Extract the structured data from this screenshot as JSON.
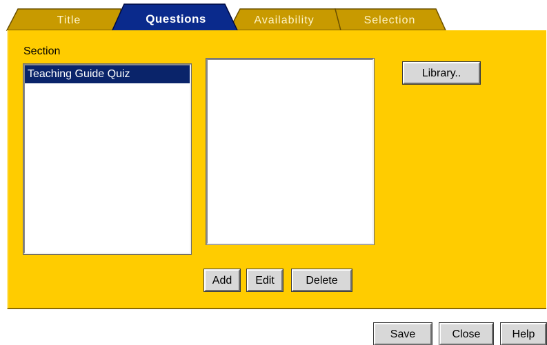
{
  "tabs": [
    {
      "label": "Title",
      "active": false
    },
    {
      "label": "Questions",
      "active": true
    },
    {
      "label": "Availability",
      "active": false
    },
    {
      "label": "Selection",
      "active": false
    }
  ],
  "colors": {
    "panel": "#ffcc00",
    "tab_inactive": "#c89a00",
    "tab_active": "#0a2a8c",
    "selection_highlight": "#0a246a"
  },
  "panel": {
    "section_label": "Section",
    "sections": [
      {
        "label": "Teaching Guide Quiz",
        "selected": true
      }
    ],
    "questions": [],
    "library_button": "Library..",
    "add_button": "Add",
    "edit_button": "Edit",
    "delete_button": "Delete"
  },
  "footer": {
    "save_button": "Save",
    "close_button": "Close",
    "help_button": "Help"
  }
}
